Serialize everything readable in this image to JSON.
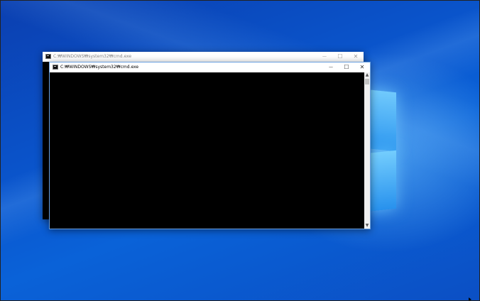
{
  "windows": {
    "back": {
      "title": "C:₩WINDOWS₩system32₩cmd.exe",
      "minimize_glyph": "—",
      "maximize_glyph": "☐",
      "close_glyph": "✕"
    },
    "front": {
      "title": "C:₩WINDOWS₩system32₩cmd.exe",
      "minimize_glyph": "—",
      "maximize_glyph": "☐",
      "close_glyph": "✕",
      "scroll_up_glyph": "▲",
      "scroll_down_glyph": "▼"
    }
  },
  "icons": [
    "cmd-icon",
    "minimize-icon",
    "maximize-icon",
    "close-icon",
    "windows-logo"
  ],
  "colors": {
    "desktop": "#0a58d0",
    "console_bg": "#000000",
    "titlebar": "#ffffff"
  }
}
